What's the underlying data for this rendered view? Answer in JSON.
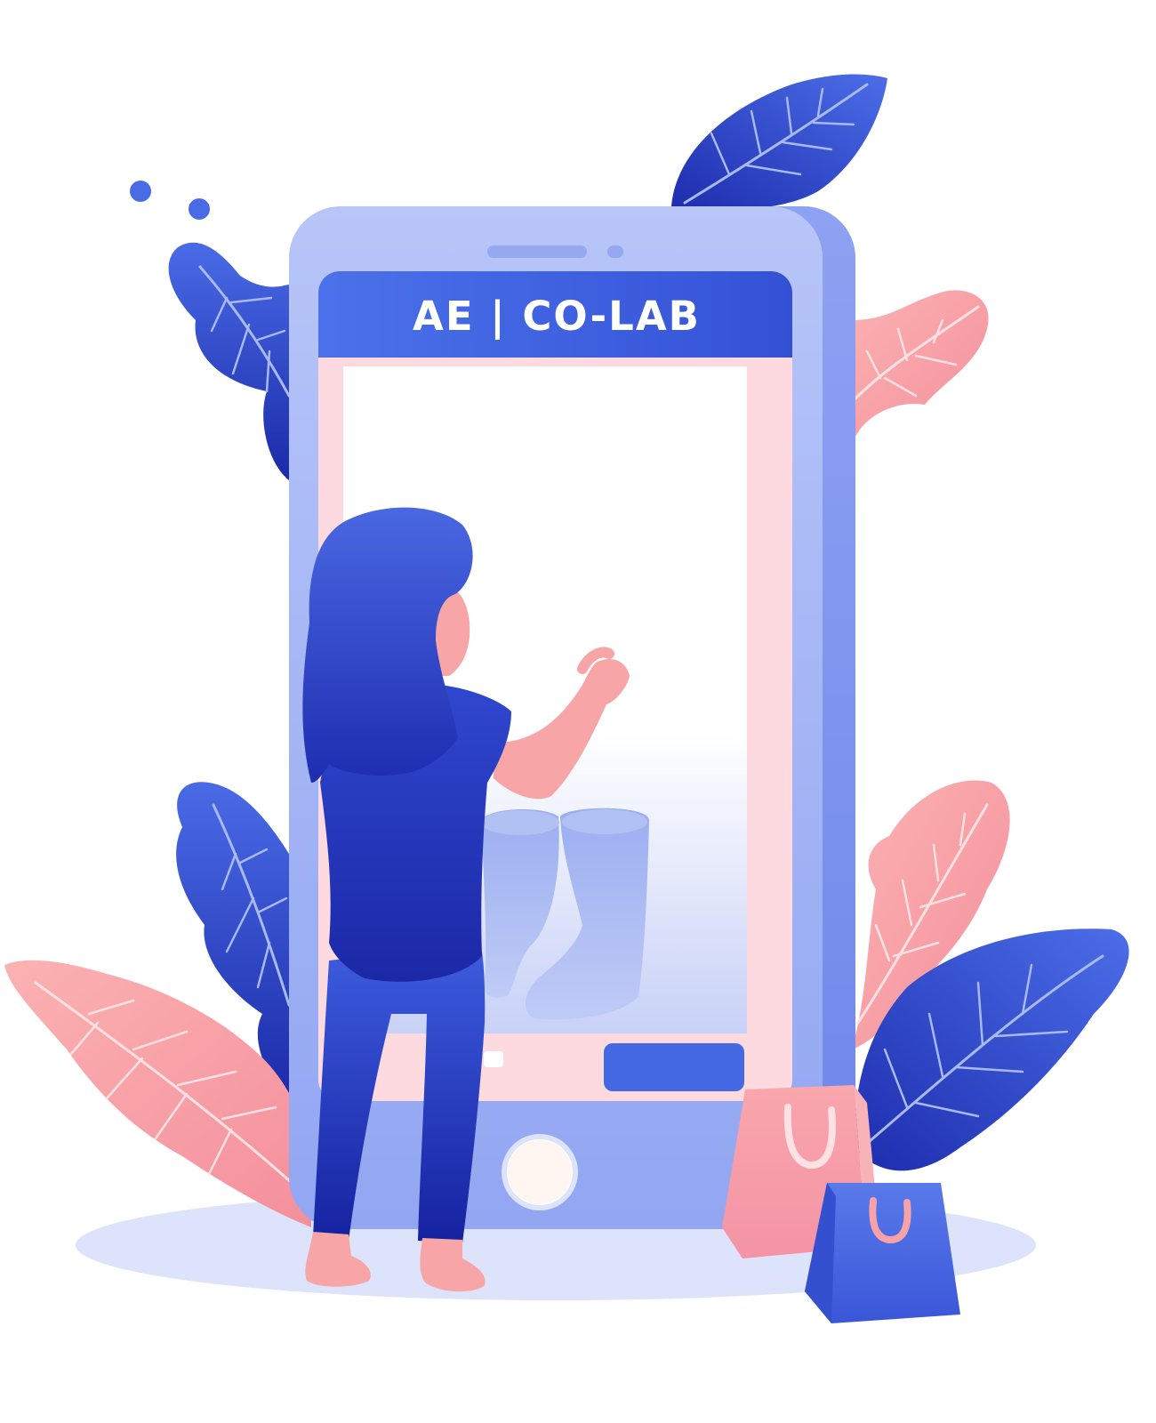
{
  "app": {
    "title": "AE | CO-LAB"
  },
  "illustration": {
    "elements": [
      "phone-frame",
      "woman-figure",
      "boots-product",
      "shopping-bag-pink",
      "shopping-bag-blue",
      "leaf-icon"
    ]
  },
  "colors": {
    "brand_blue": "#3F5FE0",
    "phone_body": "#A9B8F6",
    "screen_pink": "#FCDADF",
    "leaf_pink": "#F7A2A7",
    "leaf_blue": "#2A3FCF",
    "shadow": "#DCE3FB"
  }
}
